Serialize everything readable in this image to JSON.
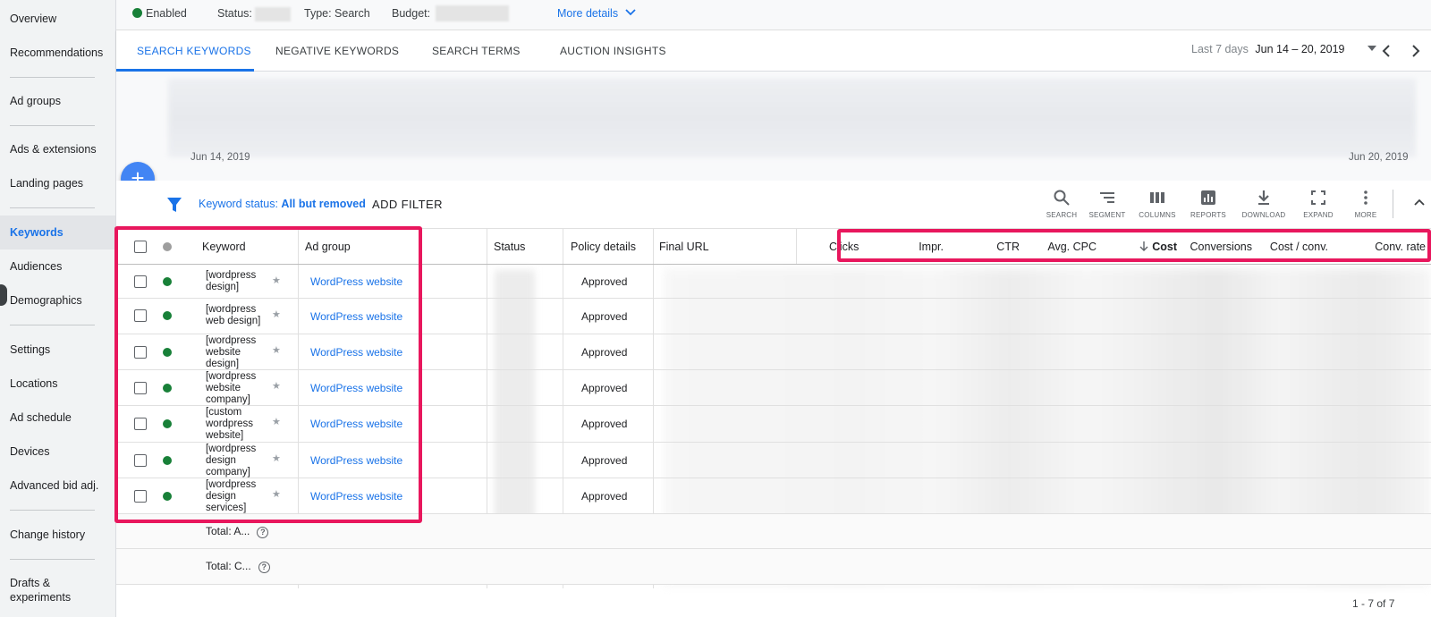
{
  "sidebar": {
    "items": [
      {
        "label": "Overview"
      },
      {
        "label": "Recommendations"
      },
      {
        "label": "Ad groups"
      },
      {
        "label": "Ads & extensions"
      },
      {
        "label": "Landing pages"
      },
      {
        "label": "Keywords",
        "active": true
      },
      {
        "label": "Audiences"
      },
      {
        "label": "Demographics"
      },
      {
        "label": "Settings"
      },
      {
        "label": "Locations"
      },
      {
        "label": "Ad schedule"
      },
      {
        "label": "Devices"
      },
      {
        "label": "Advanced bid adj."
      },
      {
        "label": "Change history"
      },
      {
        "label": "Drafts & experiments"
      }
    ]
  },
  "topbar": {
    "enabled": "Enabled",
    "status_label": "Status:",
    "type_label": "Type: Search",
    "budget_label": "Budget:",
    "more_details": "More details"
  },
  "tabs": {
    "items": [
      "SEARCH KEYWORDS",
      "NEGATIVE KEYWORDS",
      "SEARCH TERMS",
      "AUCTION INSIGHTS"
    ],
    "date_range_label": "Last 7 days",
    "date_range_value": "Jun 14 – 20, 2019"
  },
  "chart": {
    "start_date": "Jun 14, 2019",
    "end_date": "Jun 20, 2019"
  },
  "filter": {
    "status_label": "Keyword status:",
    "status_value": "All but removed",
    "add_filter": "ADD FILTER"
  },
  "toolbar": [
    "SEARCH",
    "SEGMENT",
    "COLUMNS",
    "REPORTS",
    "DOWNLOAD",
    "EXPAND",
    "MORE"
  ],
  "table": {
    "headers": {
      "keyword": "Keyword",
      "ad_group": "Ad group",
      "status": "Status",
      "policy": "Policy details",
      "final_url": "Final URL",
      "clicks": "Clicks",
      "impr": "Impr.",
      "ctr": "CTR",
      "avg_cpc": "Avg. CPC",
      "cost": "Cost",
      "conversions": "Conversions",
      "cost_conv": "Cost / conv.",
      "conv_rate": "Conv. rate"
    },
    "rows": [
      {
        "keyword": "[wordpress design]",
        "ad_group": "WordPress website",
        "policy": "Approved"
      },
      {
        "keyword": "[wordpress web design]",
        "ad_group": "WordPress website",
        "policy": "Approved"
      },
      {
        "keyword": "[wordpress website design]",
        "ad_group": "WordPress website",
        "policy": "Approved"
      },
      {
        "keyword": "[wordpress website company]",
        "ad_group": "WordPress website",
        "policy": "Approved"
      },
      {
        "keyword": "[custom wordpress website]",
        "ad_group": "WordPress website",
        "policy": "Approved"
      },
      {
        "keyword": "[wordpress design company]",
        "ad_group": "WordPress website",
        "policy": "Approved"
      },
      {
        "keyword": "[wordpress design services]",
        "ad_group": "WordPress website",
        "policy": "Approved"
      }
    ],
    "totals": [
      "Total: A...",
      "Total: C..."
    ],
    "pagination": "1 - 7 of 7"
  },
  "colors": {
    "accent": "#1a73e8",
    "enabled_green": "#188038",
    "highlight": "#e8175d"
  }
}
